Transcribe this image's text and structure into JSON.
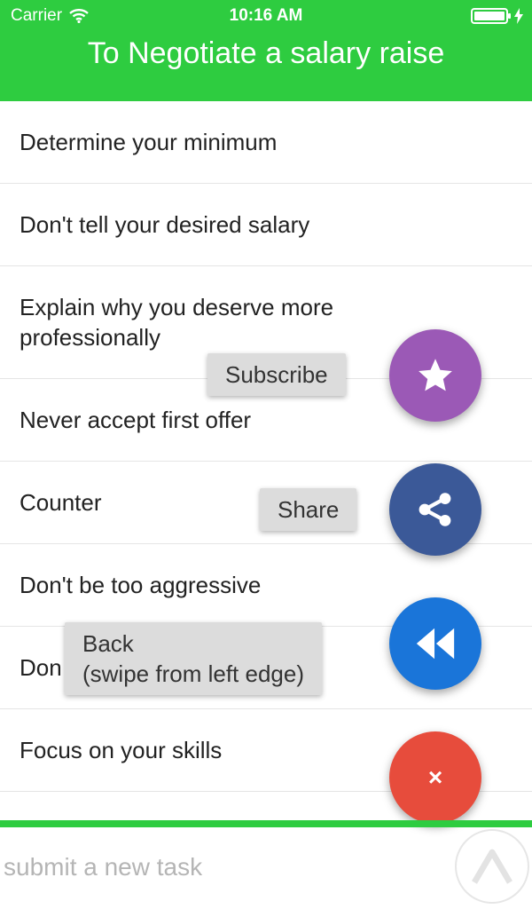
{
  "status_bar": {
    "carrier": "Carrier",
    "time": "10:16 AM"
  },
  "header": {
    "title": "To Negotiate a salary raise"
  },
  "tasks": [
    {
      "label": "Determine your minimum"
    },
    {
      "label": "Don't tell your desired salary"
    },
    {
      "label": "Explain why you deserve more professionally"
    },
    {
      "label": "Never accept first offer"
    },
    {
      "label": "Counter"
    },
    {
      "label": "Don't be too aggressive"
    },
    {
      "label": "Don"
    },
    {
      "label": "Focus on your skills"
    }
  ],
  "fab_menu": {
    "subscribe": {
      "label": "Subscribe",
      "icon": "star-icon",
      "color": "#9b59b6"
    },
    "share": {
      "label": "Share",
      "icon": "share-icon",
      "color": "#3b5998"
    },
    "back": {
      "label": "Back\n(swipe from left edge)",
      "icon": "rewind-icon",
      "color": "#1a75d9"
    },
    "close": {
      "label": "×",
      "icon": "close-icon",
      "color": "#e74c3c"
    }
  },
  "input": {
    "placeholder": "submit a new task",
    "value": ""
  },
  "colors": {
    "accent": "#2ecc40"
  }
}
